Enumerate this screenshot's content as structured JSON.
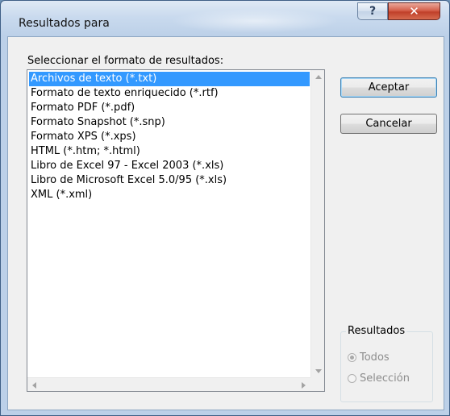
{
  "window": {
    "title": "Resultados para",
    "help_label": "?",
    "close_label": "✕"
  },
  "dialog": {
    "prompt": "Seleccionar el formato de resultados:",
    "formats": [
      "Archivos de texto (*.txt)",
      "Formato de texto enriquecido (*.rtf)",
      "Formato PDF (*.pdf)",
      "Formato Snapshot (*.snp)",
      "Formato XPS (*.xps)",
      "HTML (*.htm; *.html)",
      "Libro de Excel 97 - Excel 2003 (*.xls)",
      "Libro de Microsoft Excel 5.0/95 (*.xls)",
      "XML (*.xml)"
    ],
    "selected_format": "Archivos de texto (*.txt)"
  },
  "buttons": {
    "accept": "Aceptar",
    "cancel": "Cancelar"
  },
  "results_group": {
    "legend": "Resultados",
    "options": [
      "Todos",
      "Selección"
    ],
    "selected": "Todos",
    "enabled": false
  },
  "icons": {
    "scroll_up": "triangle-up",
    "scroll_down": "triangle-down",
    "scroll_left": "triangle-left",
    "scroll_right": "triangle-right"
  },
  "colors": {
    "selection": "#3399ff",
    "title_bar": "#c9daee",
    "close_button": "#c0402a"
  }
}
